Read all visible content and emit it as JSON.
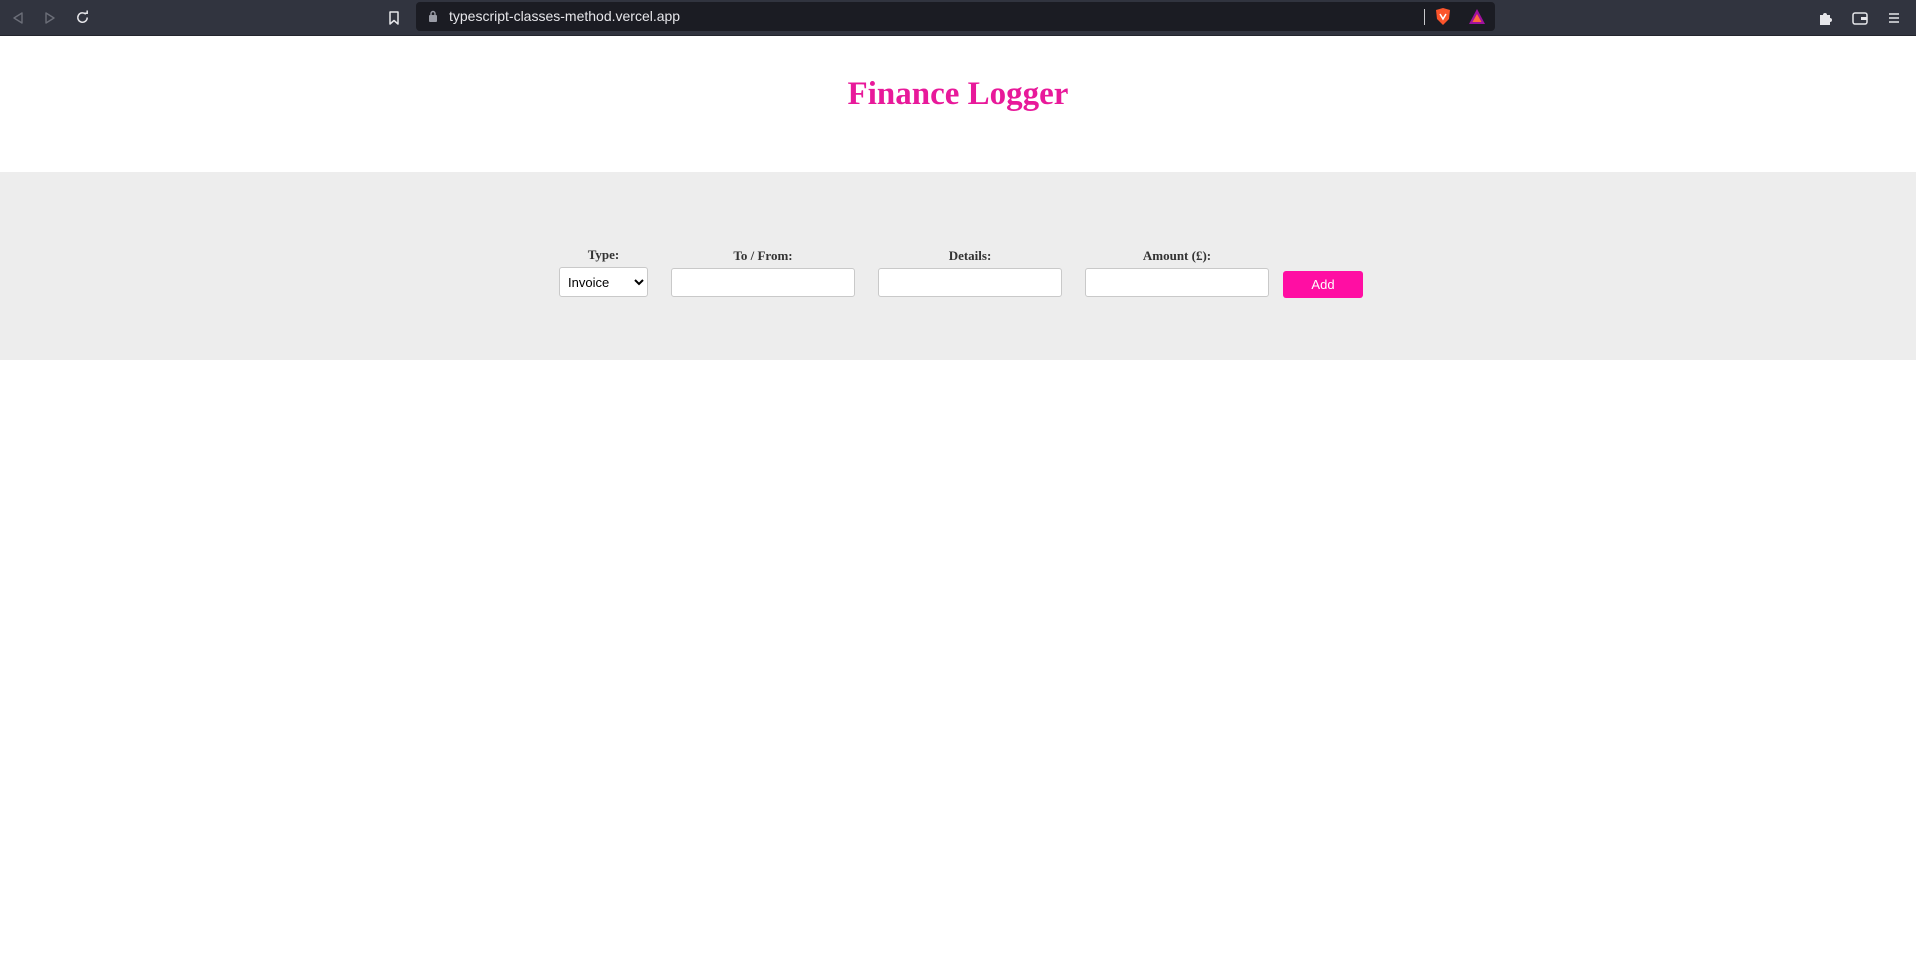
{
  "browser": {
    "url": "typescript-classes-method.vercel.app",
    "back_icon": "back-arrow-icon",
    "forward_icon": "forward-arrow-icon",
    "reload_icon": "reload-icon",
    "bookmark_icon": "bookmark-icon",
    "lock_icon": "lock-icon",
    "brave_shield_icon": "brave-shield-icon",
    "rewards_icon": "rewards-triangle-icon",
    "extensions_icon": "puzzle-icon",
    "wallet_icon": "wallet-icon",
    "menu_icon": "hamburger-menu-icon"
  },
  "page": {
    "title": "Finance Logger",
    "title_color": "#e8199a",
    "form_background": "#ededed"
  },
  "form": {
    "type_label": "Type:",
    "type_selected": "Invoice",
    "tofrom_label": "To / From:",
    "tofrom_value": "",
    "details_label": "Details:",
    "details_value": "",
    "amount_label": "Amount (£):",
    "amount_value": "",
    "add_label": "Add",
    "add_color": "#ff0ea3"
  }
}
